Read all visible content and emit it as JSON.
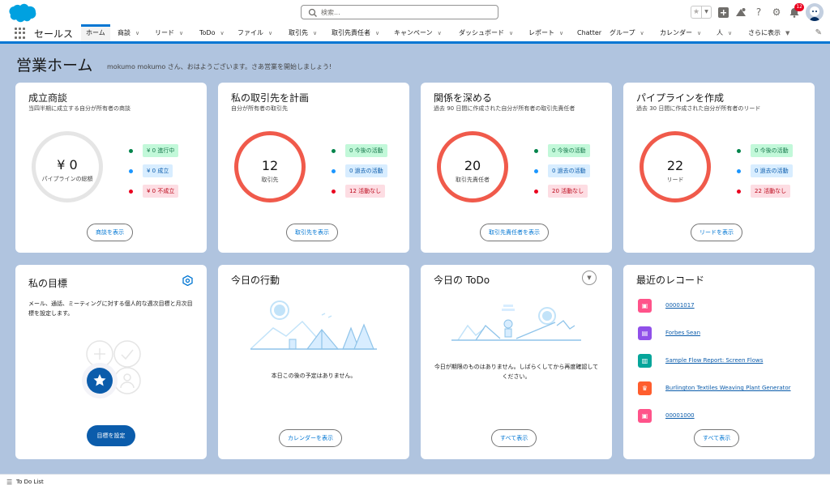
{
  "header": {
    "search_placeholder": "検索...",
    "notification_count": "12"
  },
  "nav": {
    "app_name": "セールス",
    "tabs": [
      {
        "label": "ホーム"
      },
      {
        "label": "商談"
      },
      {
        "label": "リード"
      },
      {
        "label": "ToDo"
      },
      {
        "label": "ファイル"
      },
      {
        "label": "取引先"
      },
      {
        "label": "取引先責任者"
      },
      {
        "label": "キャンペーン"
      },
      {
        "label": "ダッシュボード"
      },
      {
        "label": "レポート"
      },
      {
        "label": "Chatter"
      },
      {
        "label": "グループ"
      },
      {
        "label": "カレンダー"
      },
      {
        "label": "人"
      },
      {
        "label": "さらに表示"
      }
    ]
  },
  "page": {
    "title": "営業ホーム",
    "greeting": "mokumo mokumo さん、おはようございます。さあ営業を開始しましょう!"
  },
  "cards": {
    "deals": {
      "title": "成立商談",
      "subtitle": "当四半期に成立する自分が所有者の商談",
      "value": "¥ 0",
      "value_label": "パイプラインの総額",
      "items": [
        "¥ 0 進行中",
        "¥ 0 成立",
        "¥ 0 不成立"
      ],
      "button": "商談を表示"
    },
    "accounts": {
      "title": "私の取引先を計画",
      "subtitle": "自分が所有者の取引先",
      "value": "12",
      "value_label": "取引先",
      "items": [
        "0 今後の活動",
        "0 過去の活動",
        "12 活動なし"
      ],
      "button": "取引先を表示"
    },
    "contacts": {
      "title": "関係を深める",
      "subtitle": "過去 90 日間に作成された自分が所有者の取引先責任者",
      "value": "20",
      "value_label": "取引先責任者",
      "items": [
        "0 今後の活動",
        "0 過去の活動",
        "20 活動なし"
      ],
      "button": "取引先責任者を表示"
    },
    "leads": {
      "title": "パイプラインを作成",
      "subtitle": "過去 30 日間に作成された自分が所有者のリード",
      "value": "22",
      "value_label": "リード",
      "items": [
        "0 今後の活動",
        "0 過去の活動",
        "22 活動なし"
      ],
      "button": "リードを表示"
    },
    "goals": {
      "title": "私の目標",
      "description": "メール、通話、ミーティングに対する個人的な週次目標と月次目標を設定します。",
      "button": "目標を設定"
    },
    "events": {
      "title": "今日の行動",
      "empty": "本日この後の予定はありません。",
      "button": "カレンダーを表示"
    },
    "todo": {
      "title": "今日の ToDo",
      "empty": "今日が期限のものはありません。しばらくしてから再度確認してください。",
      "button": "すべて表示"
    },
    "recent": {
      "title": "最近のレコード",
      "records": [
        {
          "label": "00001017",
          "color": "#ff538a"
        },
        {
          "label": "Forbes Sean",
          "color": "#9050e9"
        },
        {
          "label": "Sample Flow Report: Screen Flows",
          "color": "#06a59a"
        },
        {
          "label": "Burlington Textiles Weaving Plant Generator",
          "color": "#ff5d2d"
        },
        {
          "label": "00001000",
          "color": "#ff538a"
        }
      ],
      "button": "すべて表示"
    }
  },
  "colors": {
    "brand": "#0176d3",
    "green": "#04844b",
    "blue": "#1b96ff",
    "red": "#ea001e",
    "ring_gray": "#e5e5e5",
    "ring_red": "#f05a4b"
  },
  "footer": {
    "label": "To Do List"
  }
}
